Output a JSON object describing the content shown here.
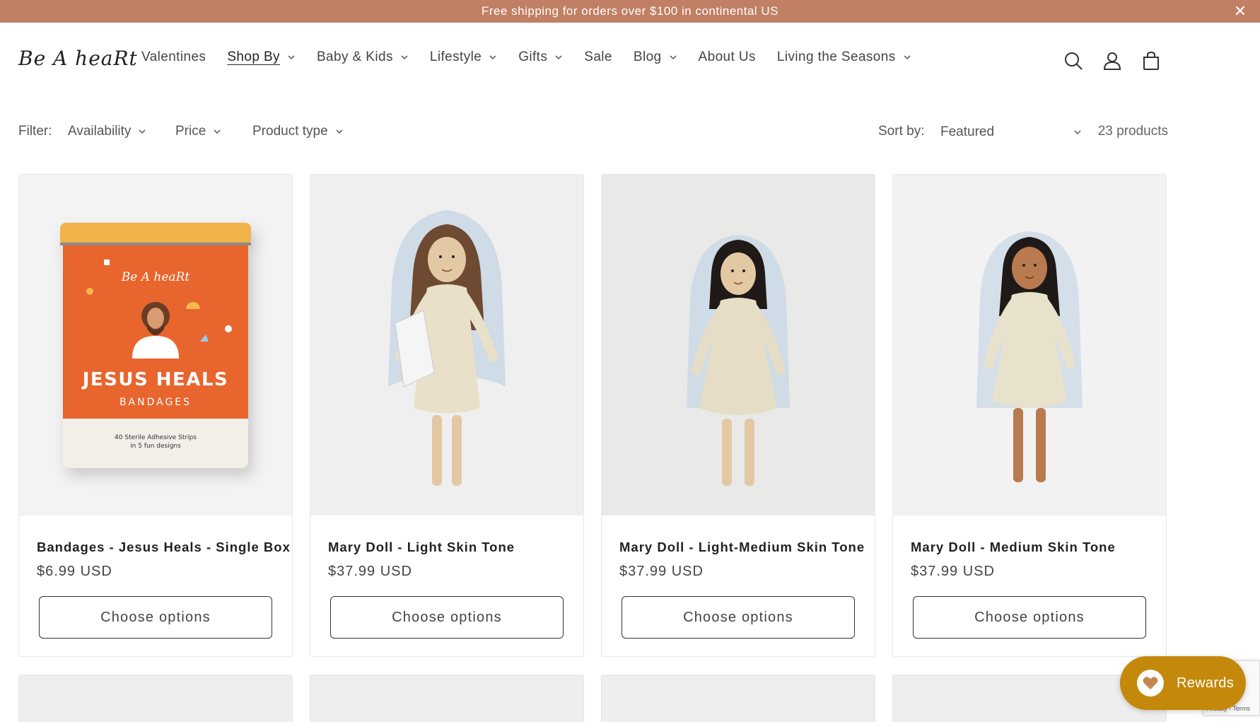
{
  "announcement": {
    "text": "Free shipping for orders over $100 in continental US",
    "close_glyph": "✕"
  },
  "header": {
    "logo_text": "Be A heaRt",
    "nav": [
      {
        "label": "Valentines",
        "has_dropdown": false,
        "active": false
      },
      {
        "label": "Shop By",
        "has_dropdown": true,
        "active": true
      },
      {
        "label": "Baby & Kids",
        "has_dropdown": true,
        "active": false
      },
      {
        "label": "Lifestyle",
        "has_dropdown": true,
        "active": false
      },
      {
        "label": "Gifts",
        "has_dropdown": true,
        "active": false
      },
      {
        "label": "Sale",
        "has_dropdown": false,
        "active": false
      },
      {
        "label": "Blog",
        "has_dropdown": true,
        "active": false
      },
      {
        "label": "About Us",
        "has_dropdown": false,
        "active": false
      },
      {
        "label": "Living the Seasons",
        "has_dropdown": true,
        "active": false
      }
    ],
    "icons": [
      "search-icon",
      "account-icon",
      "cart-icon"
    ]
  },
  "filters": {
    "filter_label": "Filter:",
    "availability": "Availability",
    "price": "Price",
    "product_type": "Product type",
    "sort_label": "Sort by:",
    "sort_value": "Featured",
    "product_count": "23 products"
  },
  "products": [
    {
      "title": "Bandages - Jesus Heals - Single Box",
      "price": "$6.99 USD",
      "button": "Choose options"
    },
    {
      "title": "Mary Doll - Light Skin Tone",
      "price": "$37.99 USD",
      "button": "Choose options"
    },
    {
      "title": "Mary Doll - Light-Medium Skin Tone",
      "price": "$37.99 USD",
      "button": "Choose options"
    },
    {
      "title": "Mary Doll - Medium Skin Tone",
      "price": "$37.99 USD",
      "button": "Choose options"
    }
  ],
  "bandage_box": {
    "brand": "Be A heaRt",
    "line1": "JESUS HEALS",
    "line2": "BANDAGES",
    "fine1": "40 Sterile Adhesive Strips",
    "fine2": "in 5 fun designs"
  },
  "rewards": {
    "label": "Rewards"
  },
  "recaptcha": {
    "text": "Privacy - Terms"
  },
  "colors": {
    "announcement_bg": "#c17f63",
    "rewards_bg": "#c4880a",
    "box_orange": "#e8652e",
    "box_lid": "#f0b24a"
  }
}
